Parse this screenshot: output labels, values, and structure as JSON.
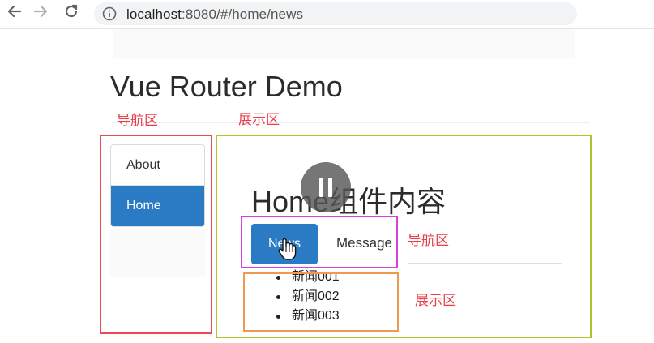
{
  "browser": {
    "url_host": "localhost",
    "url_rest": ":8080/#/home/news",
    "icons": [
      "back-icon",
      "forward-icon",
      "reload-icon",
      "info-icon"
    ]
  },
  "page": {
    "title": "Vue Router Demo"
  },
  "annotations": {
    "nav_left": "导航区",
    "display_top": "展示区",
    "nav_right": "导航区",
    "display_right": "展示区",
    "colors": {
      "red": "#e84b55",
      "green": "#a9c72c",
      "magenta": "#d93fdc",
      "orange": "#f09a4d"
    }
  },
  "sidebar": {
    "items": [
      {
        "label": "About",
        "active": false
      },
      {
        "label": "Home",
        "active": true
      }
    ],
    "active_color": "#2a7bc4"
  },
  "home": {
    "heading": "Home组件内容",
    "tabs": [
      {
        "label": "News",
        "active": true
      },
      {
        "label": "Message",
        "active": false
      }
    ],
    "news": [
      "新闻001",
      "新闻002",
      "新闻003"
    ]
  },
  "overlay": {
    "icon": "pause-icon"
  }
}
